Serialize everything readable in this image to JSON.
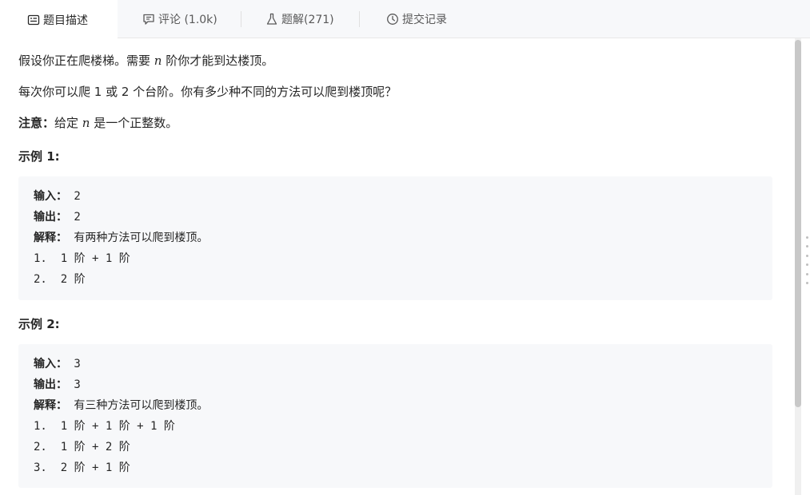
{
  "tabs": [
    {
      "label": "题目描述",
      "icon": "description-icon",
      "active": true
    },
    {
      "label": "评论 (1.0k)",
      "icon": "comment-icon",
      "active": false
    },
    {
      "label": "题解(271)",
      "icon": "flask-icon",
      "active": false
    },
    {
      "label": "提交记录",
      "icon": "clock-icon",
      "active": false
    }
  ],
  "problem": {
    "p1_a": "假设你正在爬楼梯。需要 ",
    "p1_var": "n",
    "p1_b": " 阶你才能到达楼顶。",
    "p2": "每次你可以爬 1 或 2 个台阶。你有多少种不同的方法可以爬到楼顶呢？",
    "note_label": "注意：",
    "note_a": "给定 ",
    "note_var": "n",
    "note_b": " 是一个正整数。"
  },
  "examples": [
    {
      "title": "示例 1:",
      "input_label": "输入：",
      "input_value": " 2",
      "output_label": "输出：",
      "output_value": " 2",
      "explain_label": "解释：",
      "explain_value": " 有两种方法可以爬到楼顶。",
      "steps": [
        "1.  1 阶 + 1 阶",
        "2.  2 阶"
      ]
    },
    {
      "title": "示例 2:",
      "input_label": "输入：",
      "input_value": " 3",
      "output_label": "输出：",
      "output_value": " 3",
      "explain_label": "解释：",
      "explain_value": " 有三种方法可以爬到楼顶。",
      "steps": [
        "1.  1 阶 + 1 阶 + 1 阶",
        "2.  1 阶 + 2 阶",
        "3.  2 阶 + 1 阶"
      ]
    }
  ],
  "colors": {
    "accent_tab_bg": "#ffffff",
    "tabbar_bg": "#f7f8fa",
    "code_bg": "#f7f8fa"
  }
}
